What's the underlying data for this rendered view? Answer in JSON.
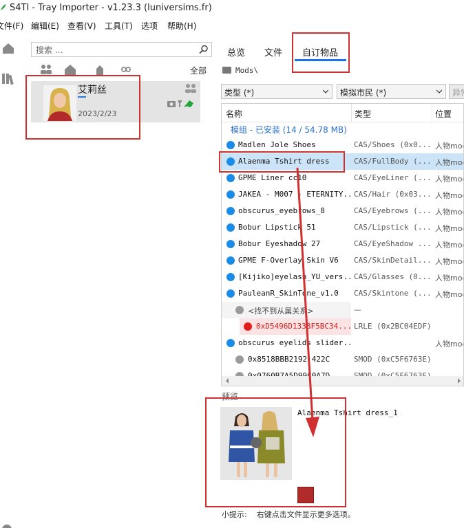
{
  "window": {
    "title": "S4TI - Tray Importer - v1.23.3  (luniversims.fr)"
  },
  "menu": [
    "文件(F)",
    "编辑(E)",
    "查看(V)",
    "工具(T)",
    "选项",
    "帮助(H)"
  ],
  "search": {
    "placeholder": "搜索 ..."
  },
  "left_panel": {
    "all_label": "全部"
  },
  "sim": {
    "name": "艾莉丝",
    "date": "2023/2/23"
  },
  "tabs": [
    {
      "label": "总览",
      "active": false
    },
    {
      "label": "文件",
      "active": false
    },
    {
      "label": "自订物品",
      "active": true
    }
  ],
  "breadcrumb": "Mods\\",
  "filters": {
    "type_combo": "类型 (*)",
    "sim_combo": "模拟市民 (*)",
    "extra_button": "异常"
  },
  "columns": {
    "name": "名称",
    "type": "类型",
    "location": "位置"
  },
  "group": {
    "label": "模组 - 已安装  (14 / 54.78 MB)"
  },
  "rows": [
    {
      "name": "Madlen Jole Shoes",
      "type": "CAS/Shoes (0x0...",
      "loc": "人物mod",
      "dot": "#1a8be6"
    },
    {
      "name": "Alaenma Tshirt dress",
      "type": "CAS/FullBody (...",
      "loc": "人物mod",
      "dot": "#1a8be6"
    },
    {
      "name": "GPME Liner cc10",
      "type": "CAS/EyeLiner (...",
      "loc": "人物mod",
      "dot": "#1a8be6"
    },
    {
      "name": "JAKEA - M007 - ETERNITY...",
      "type": "CAS/Hair (0x03...",
      "loc": "人物mod",
      "dot": "#1a8be6"
    },
    {
      "name": "obscurus_eyebrows_8",
      "type": "CAS/Eyebrows (...",
      "loc": "人物mod",
      "dot": "#1a8be6"
    },
    {
      "name": "Bobur Lipstick 51",
      "type": "CAS/Lipstick (...",
      "loc": "人物mod",
      "dot": "#1a8be6"
    },
    {
      "name": "Bobur Eyeshadow 27",
      "type": "CAS/EyeShadow ...",
      "loc": "人物mod",
      "dot": "#1a8be6"
    },
    {
      "name": "GPME F-Overlay Skin V6",
      "type": "CAS/SkinDetail...",
      "loc": "人物mod",
      "dot": "#1a8be6"
    },
    {
      "name": "[Kijiko]eyelash_YU_vers...",
      "type": "CAS/Glasses (0...",
      "loc": "人物mod",
      "dot": "#1a8be6"
    },
    {
      "name": "PauleanR_SkinTone_v1.0",
      "type": "CAS/Skintone (...",
      "loc": "人物mod",
      "dot": "#1a8be6"
    }
  ],
  "missing_group": {
    "label": "<找不到从属关系>",
    "type": "—"
  },
  "missing_row": {
    "name": "0xD5496D1338F5BC34...",
    "type": "LRLE (0x2BC04EDF)"
  },
  "rows_after": [
    {
      "name": "obscurus eyelids slider...",
      "type": "",
      "loc": "人物mod"
    },
    {
      "name": "0x8518BBB2192 422C",
      "type": "SMOD (0xC5F6763E)",
      "loc": ""
    },
    {
      "name": "0x0760B7A5D99C0A7D",
      "type": "SMOD (0xC5F6763E)",
      "loc": ""
    }
  ],
  "preview": {
    "label": "预览",
    "item_name": "Alaenma Tshirt dress_1",
    "swatch_color": "#b22b2b"
  },
  "tip": {
    "label": "小提示:",
    "text": "右键点击文件显示更多选项。"
  },
  "colors": {
    "accent": "#1a73e8",
    "highlight": "#d03030",
    "selection": "#cce4f7"
  }
}
